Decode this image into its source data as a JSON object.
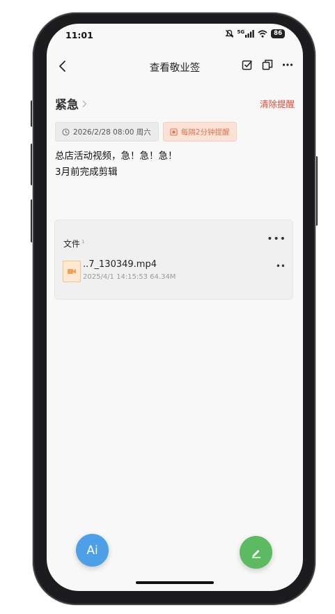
{
  "status_bar": {
    "time": "11:01",
    "network": "5G",
    "battery": "86",
    "icons": [
      "mute-icon",
      "signal-icon",
      "wifi-icon",
      "battery-icon"
    ]
  },
  "appbar": {
    "title": "查看敬业签",
    "icons": [
      "back-icon",
      "checkbox-icon",
      "copy-icon",
      "more-icon"
    ]
  },
  "note": {
    "category": "紧急",
    "clear_reminder": "清除提醒",
    "date_chip": "2026/2/28 08:00 周六",
    "remind_chip": "每隔2分钟提醒",
    "lines": [
      "总店活动视频，急！急！急！",
      "3月前完成剪辑"
    ]
  },
  "files": {
    "label": "文件",
    "count_sup": "1",
    "items": [
      {
        "name": "..7_130349.mp4",
        "meta": "2025/4/1 14:15:53 64.34M",
        "icon": "video-file-icon"
      }
    ]
  },
  "fab": {
    "ai_label": "Ai",
    "edit_icon": "pencil-icon"
  },
  "colors": {
    "accent_red": "#d94b3a",
    "remind_orange": "#e0734f",
    "ai_blue": "#4d9fe8",
    "edit_green": "#5cba62"
  }
}
